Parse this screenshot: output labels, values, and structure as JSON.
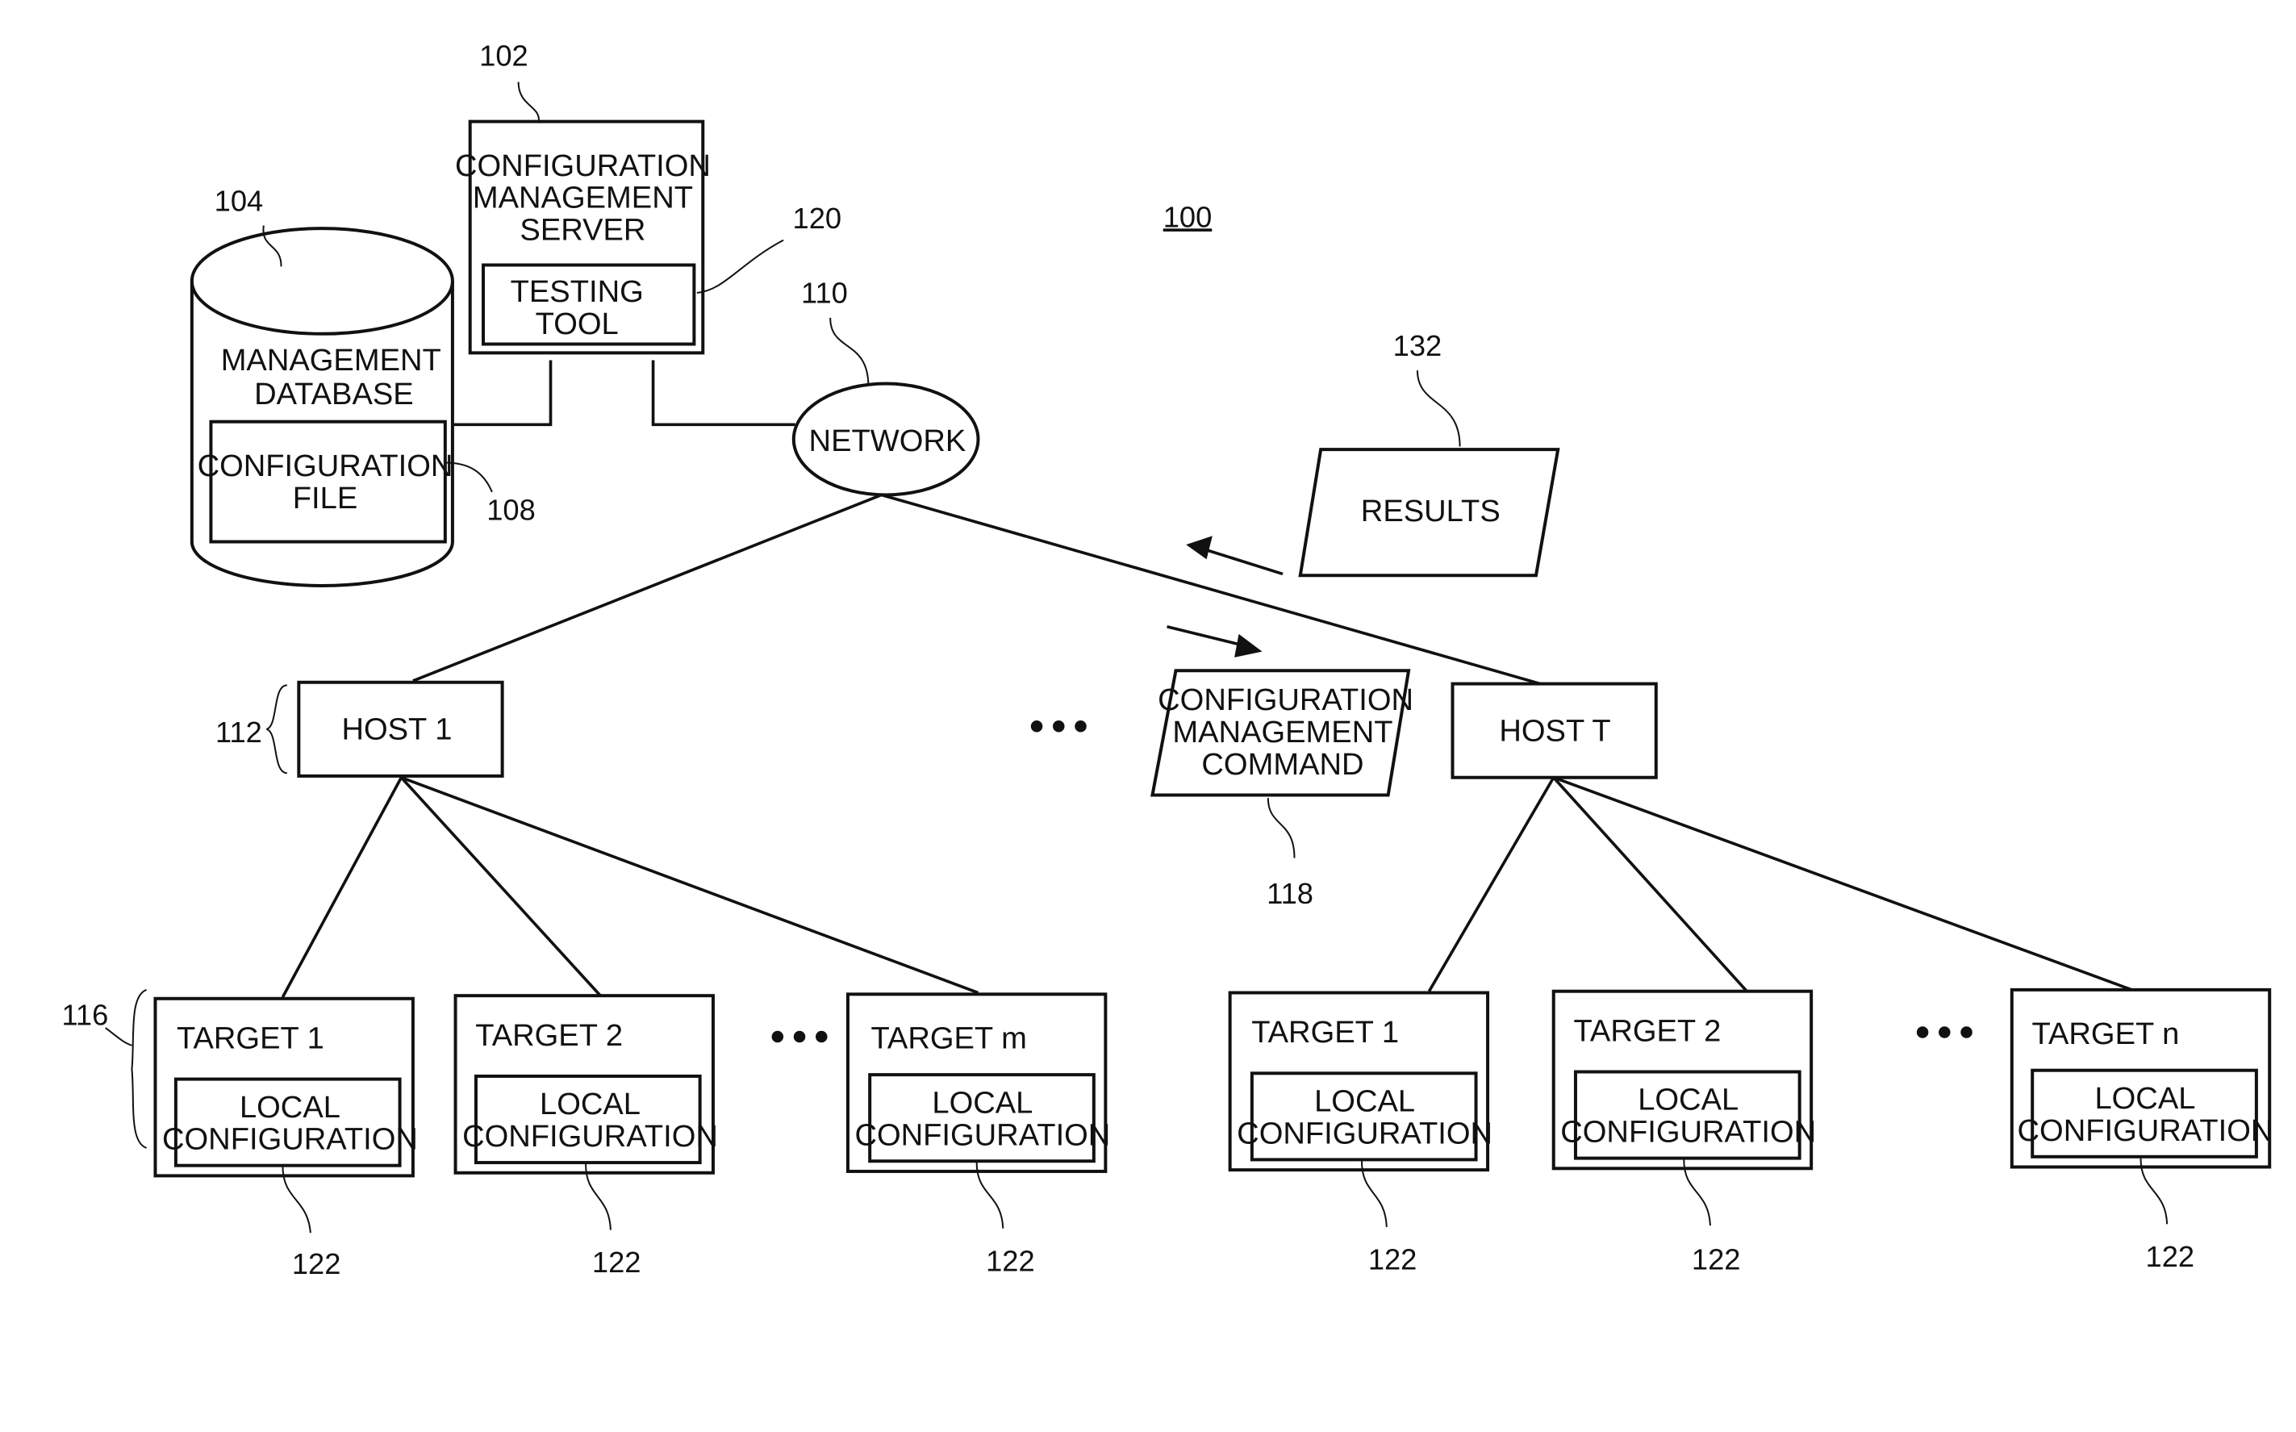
{
  "figure": {
    "ref": "100",
    "server": {
      "ref": "102",
      "lines": [
        "CONFIGURATION",
        "MANAGEMENT",
        "SERVER"
      ]
    },
    "testing_tool": {
      "ref": "120",
      "lines": [
        "TESTING",
        "TOOL"
      ]
    },
    "database": {
      "ref": "104",
      "lines": [
        "MANAGEMENT",
        "DATABASE"
      ]
    },
    "config_file": {
      "ref": "108",
      "lines": [
        "CONFIGURATION",
        "FILE"
      ]
    },
    "network": {
      "ref": "110",
      "label": "NETWORK"
    },
    "results": {
      "ref": "132",
      "label": "RESULTS"
    },
    "command": {
      "ref": "118",
      "lines": [
        "CONFIGURATION",
        "MANAGEMENT",
        "COMMAND"
      ]
    },
    "hosts": [
      {
        "label": "HOST 1",
        "ref": "112"
      },
      {
        "label": "HOST T"
      }
    ],
    "targets_group_ref": "116",
    "targets": [
      {
        "label": "TARGET 1",
        "local": [
          "LOCAL",
          "CONFIGURATION"
        ],
        "ref": "122"
      },
      {
        "label": "TARGET 2",
        "local": [
          "LOCAL",
          "CONFIGURATION"
        ],
        "ref": "122"
      },
      {
        "label": "TARGET m",
        "local": [
          "LOCAL",
          "CONFIGURATION"
        ],
        "ref": "122"
      },
      {
        "label": "TARGET 1",
        "local": [
          "LOCAL",
          "CONFIGURATION"
        ],
        "ref": "122"
      },
      {
        "label": "TARGET 2",
        "local": [
          "LOCAL",
          "CONFIGURATION"
        ],
        "ref": "122"
      },
      {
        "label": "TARGET n",
        "local": [
          "LOCAL",
          "CONFIGURATION"
        ],
        "ref": "122"
      }
    ],
    "ellipsis": "..."
  }
}
